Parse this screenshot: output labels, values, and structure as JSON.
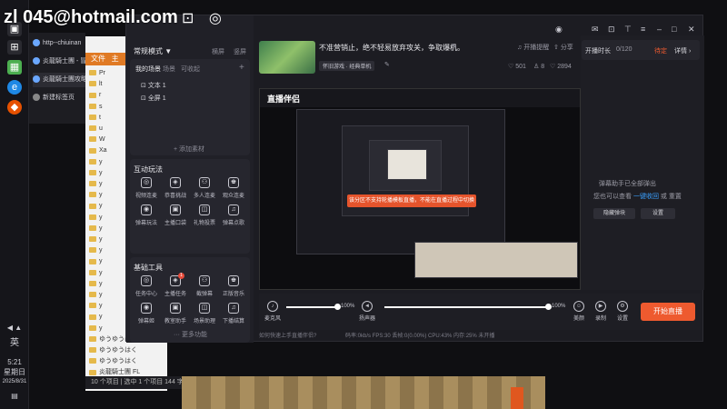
{
  "watermark": "zl 045@hotmail.com",
  "window_title": "炎龍騎士團攻略",
  "taskbar": {
    "time": "5:21",
    "weekday": "星期日",
    "date": "2025/8/31",
    "ime": "英"
  },
  "browser_tabs": [
    {
      "label": "http--chiuinan"
    },
    {
      "label": "炎龍騎士團 - 冒"
    },
    {
      "label": "炎龍騎士團攻略"
    },
    {
      "label": "新建标签页"
    }
  ],
  "explorer": {
    "tabs": [
      "文件",
      "主"
    ],
    "rows": [
      "Pr",
      "lt",
      "r",
      "s",
      "t",
      "u",
      "W",
      "Xa",
      "y",
      "y",
      "y",
      "y",
      "y",
      "y",
      "y",
      "y",
      "y",
      "y",
      "y",
      "y",
      "y",
      "y",
      "y",
      "y",
      "ゆうゆうはく",
      "ゆうゆうはく",
      "ゆうゆうはく",
      "炎龍騎士團 FL"
    ],
    "status": "10 个项目  |  选中 1 个项目  144 字节  |"
  },
  "app": {
    "scene_mode": "常规模式 ▼",
    "scene_actions": [
      "横屏",
      "竖屏"
    ],
    "scene_tabs": [
      "我的场景",
      "场景",
      "可收起"
    ],
    "scenes": [
      "文本 1",
      "全屏 1"
    ],
    "add_material": "+ 添加素材",
    "section_interactive": "互动玩法",
    "interactive_tools": [
      "视频连麦",
      "恭喜挑战",
      "多人连麦",
      "观众连麦",
      "弹幕玩法",
      "主播口袋",
      "礼物投票",
      "弹幕点歌"
    ],
    "section_basic": "基础工具",
    "basic_tools": [
      "任务中心",
      "主播任务",
      "截弹幕",
      "正版音乐",
      "弹幕姬",
      "教室助手",
      "场景助理",
      "下播结算"
    ],
    "basic_badge": "1",
    "more": "··· 更多功能",
    "help": "如何快速上手直播伴侣?",
    "title_text": "不准营销止，绝不轻易放弃攻关，争取爆机。",
    "category_chip": "怀旧游戏 · 经典单机",
    "top_actions": [
      "开播提醒",
      "分享"
    ],
    "stats": [
      "501",
      "8",
      "2894"
    ],
    "timer_label": "开播时长",
    "timer_value": "0/120",
    "timer_status": "待定",
    "timer_details": "详情 ›",
    "preview_logo": "直播伴侣",
    "toast_text": "该分区不支持轮播模板直播，不能在直播过程中切换",
    "danmu_info": "弹幕助手已全部弹出",
    "danmu_info2": "您也可以查看",
    "danmu_link": "一键收回",
    "danmu_link_after": "或 重置",
    "danmu_buttons": [
      "隐藏弹块",
      "设置"
    ],
    "controls": {
      "mic_label": "麦克风",
      "mic_value": "100%",
      "speaker_label": "扬声器",
      "speaker_value": "100%",
      "mic_level": 1.0,
      "speaker_level": 1.0,
      "right_icons": [
        "美颜",
        "录制",
        "设置"
      ],
      "start_button": "开始直播"
    },
    "statusbar": "码率:0kb/s   FPS:30   丢帧:0(0.00%)   CPU:43%   内存:25%   未开播"
  }
}
